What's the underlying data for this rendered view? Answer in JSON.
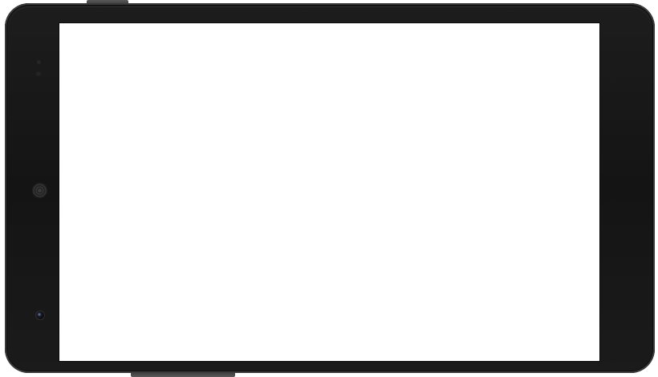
{
  "device": {
    "model": "",
    "orientation": "landscape",
    "body_color": "#151515",
    "screen_color": "#ffffff"
  },
  "screen": {
    "content": ""
  }
}
